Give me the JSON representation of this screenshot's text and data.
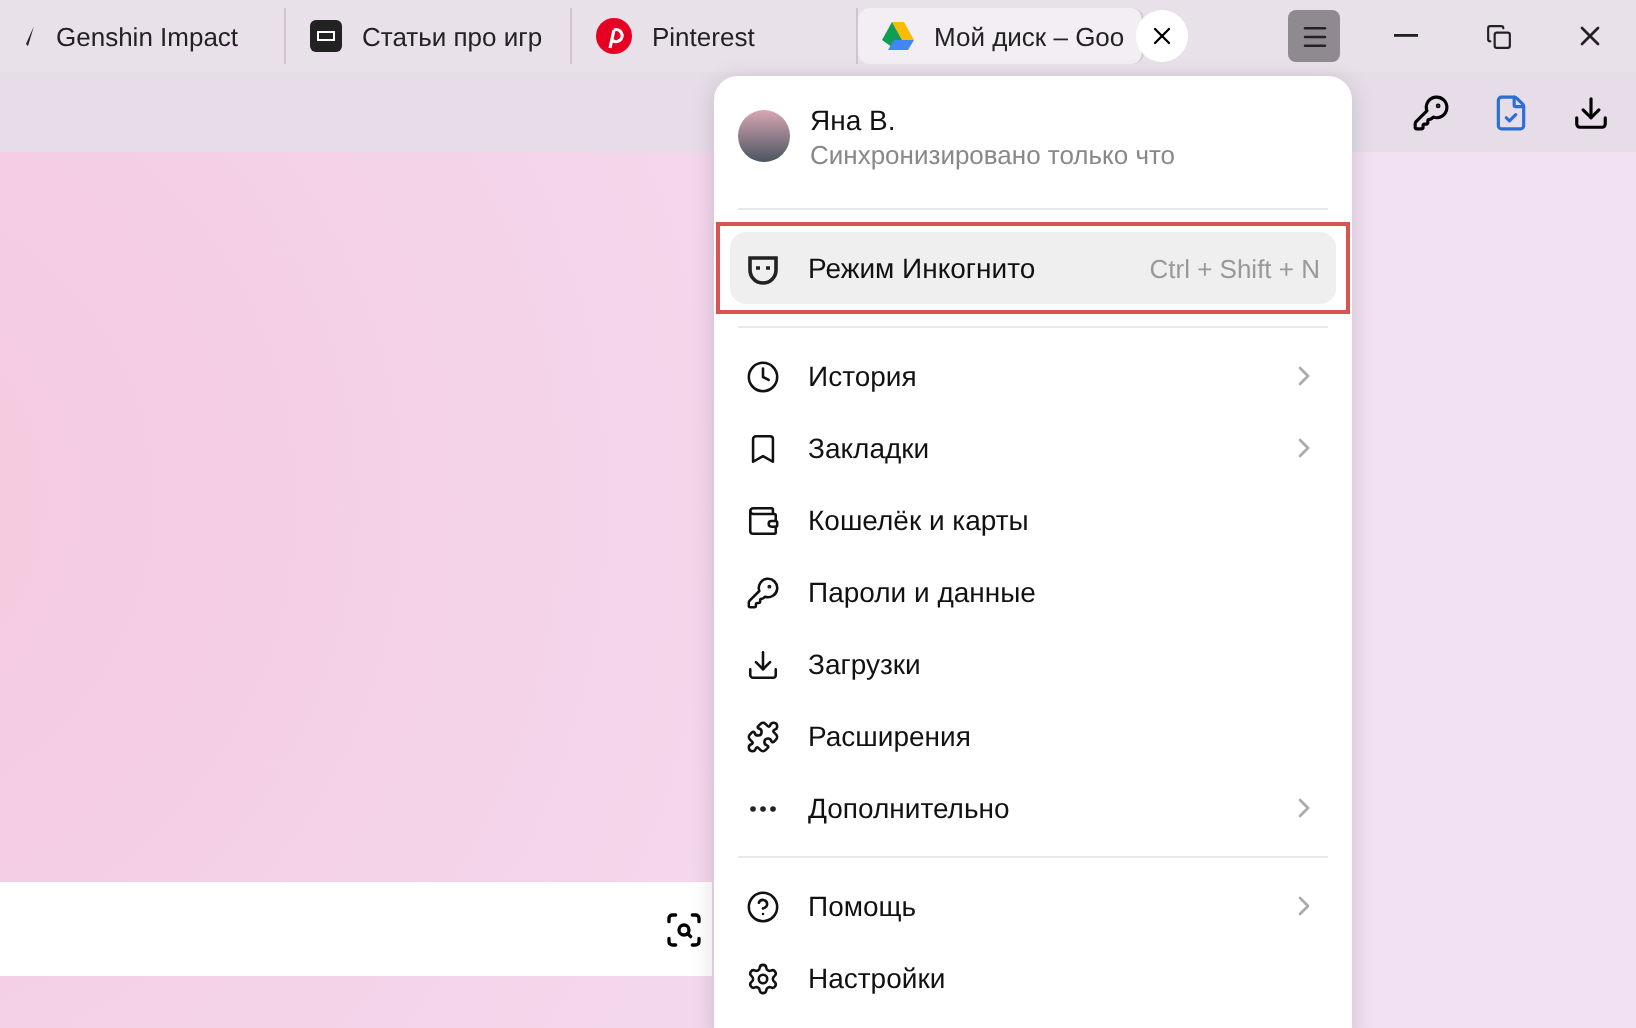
{
  "tabs": [
    {
      "title": "Genshin Impact",
      "selected": false
    },
    {
      "title": "Статьи про игр",
      "selected": false
    },
    {
      "title": "Pinterest",
      "selected": false
    },
    {
      "title": "Мой диск – Goo",
      "selected": true
    }
  ],
  "window_controls": {
    "menu_open": true
  },
  "profile": {
    "name": "Яна В.",
    "status": "Синхронизировано только что"
  },
  "menu_groups": [
    [
      {
        "label": "Режим Инкогнито",
        "shortcut": "Ctrl + Shift + N",
        "has_submenu": false,
        "highlighted": true
      }
    ],
    [
      {
        "label": "История",
        "has_submenu": true,
        "highlighted": false
      },
      {
        "label": "Закладки",
        "has_submenu": true,
        "highlighted": false
      },
      {
        "label": "Кошелёк и карты",
        "has_submenu": false,
        "highlighted": false
      },
      {
        "label": "Пароли и данные",
        "has_submenu": false,
        "highlighted": false
      },
      {
        "label": "Загрузки",
        "has_submenu": false,
        "highlighted": false
      },
      {
        "label": "Расширения",
        "has_submenu": false,
        "highlighted": false
      },
      {
        "label": "Дополнительно",
        "has_submenu": true,
        "highlighted": false
      }
    ],
    [
      {
        "label": "Помощь",
        "has_submenu": true,
        "highlighted": false
      },
      {
        "label": "Настройки",
        "has_submenu": false,
        "highlighted": false
      }
    ]
  ]
}
